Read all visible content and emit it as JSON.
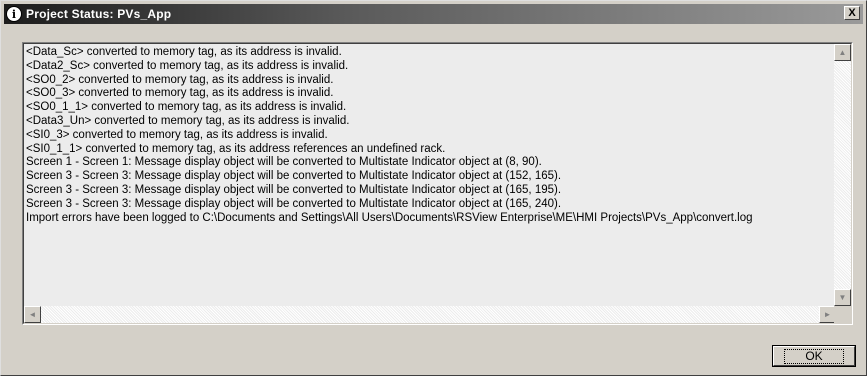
{
  "window": {
    "title": "Project Status: PVs_App",
    "icon": "info-icon",
    "close_label": "X"
  },
  "log": {
    "lines": [
      "<Data_Sc> converted to memory tag, as its address is invalid.",
      "<Data2_Sc> converted to memory tag, as its address is invalid.",
      "<SO0_2> converted to memory tag, as its address is invalid.",
      "<SO0_3> converted to memory tag, as its address is invalid.",
      "<SO0_1_1> converted to memory tag, as its address is invalid.",
      "<Data3_Un> converted to memory tag, as its address is invalid.",
      "<SI0_3> converted to memory tag, as its address is invalid.",
      "<SI0_1_1> converted to memory tag, as its address references an undefined rack.",
      "Screen 1 - Screen 1: Message display object will be converted to Multistate Indicator object at (8, 90).",
      "Screen 3 - Screen 3: Message display object will be converted to Multistate Indicator object at (152, 165).",
      "Screen 3 - Screen 3: Message display object will be converted to Multistate Indicator object at (165, 195).",
      "Screen 3 - Screen 3: Message display object will be converted to Multistate Indicator object at (165, 240).",
      "Import errors have been logged to C:\\Documents and Settings\\All Users\\Documents\\RSView Enterprise\\ME\\HMI Projects\\PVs_App\\convert.log"
    ]
  },
  "scrollbars": {
    "up_glyph": "▲",
    "down_glyph": "▼",
    "left_glyph": "◄",
    "right_glyph": "►"
  },
  "buttons": {
    "ok_label": "OK"
  }
}
